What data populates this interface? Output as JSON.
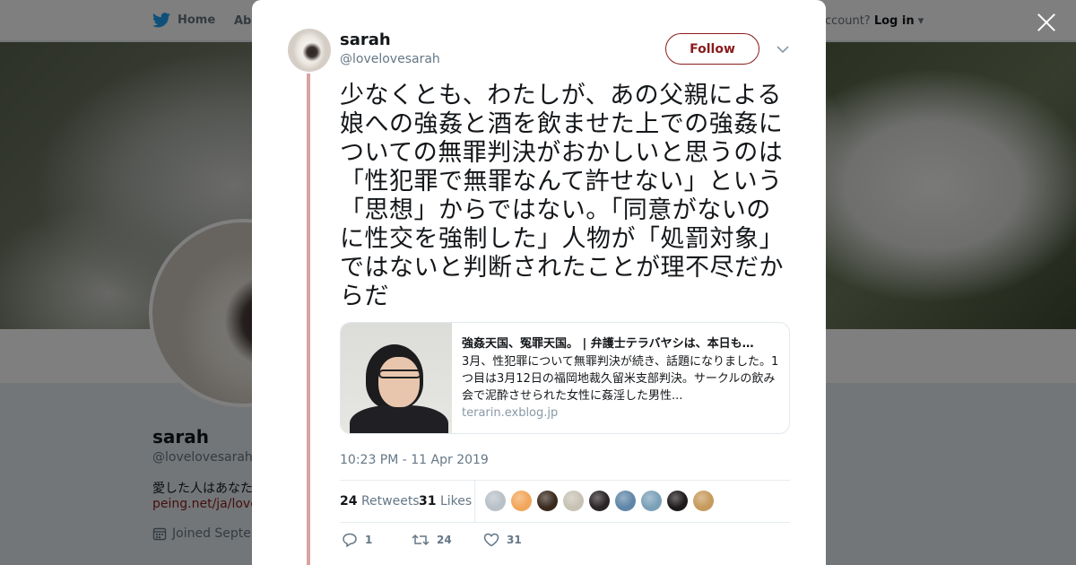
{
  "nav": {
    "home_label": "Home",
    "about_label": "Abo",
    "account_prompt": "account?",
    "login_label": "Log in"
  },
  "profile": {
    "name": "sarah",
    "handle": "@lovelovesarah",
    "bio": "愛した人はあなた",
    "link": "peing.net/ja/lovelo",
    "joined": "Joined Septem"
  },
  "tweet": {
    "name": "sarah",
    "handle": "@lovelovesarah",
    "follow_label": "Follow",
    "text": "少なくとも、わたしが、あの父親による娘への強姦と酒を飲ませた上での強姦についての無罪判決がおかしいと思うのは「性犯罪で無罪なんて許せない」という「思想」からではない。「同意がないのに性交を強制した」人物が「処罰対象」ではないと判断されたことが理不尽だからだ",
    "card": {
      "title": "強姦天国、冤罪天国。 | 弁護士テラバヤシは、本日も…",
      "description": "3月、性犯罪について無罪判決が続き、話題になりました。1つ目は3月12日の福岡地裁久留米支部判決。サークルの飲み会で泥酔させられた女性に姦淫した男性...",
      "domain": "terarin.exblog.jp"
    },
    "timestamp": "10:23 PM - 11 Apr 2019",
    "retweets_count": "24",
    "retweets_label": "Retweets",
    "likes_count": "31",
    "likes_label": "Likes",
    "reply_count": "1",
    "retweet_action_count": "24",
    "like_action_count": "31"
  },
  "colors": {
    "accent": "#8a1a1a",
    "thread_line": "#d9a3a0"
  },
  "likers": [
    {
      "color": "#b8c0c8"
    },
    {
      "color": "#f2a65a"
    },
    {
      "color": "#3a2a1e"
    },
    {
      "color": "#c8c2b4"
    },
    {
      "color": "#2a2426"
    },
    {
      "color": "#5f86a8"
    },
    {
      "color": "#7aa0b8"
    },
    {
      "color": "#1e1a1c"
    },
    {
      "color": "#c69a5c"
    }
  ]
}
